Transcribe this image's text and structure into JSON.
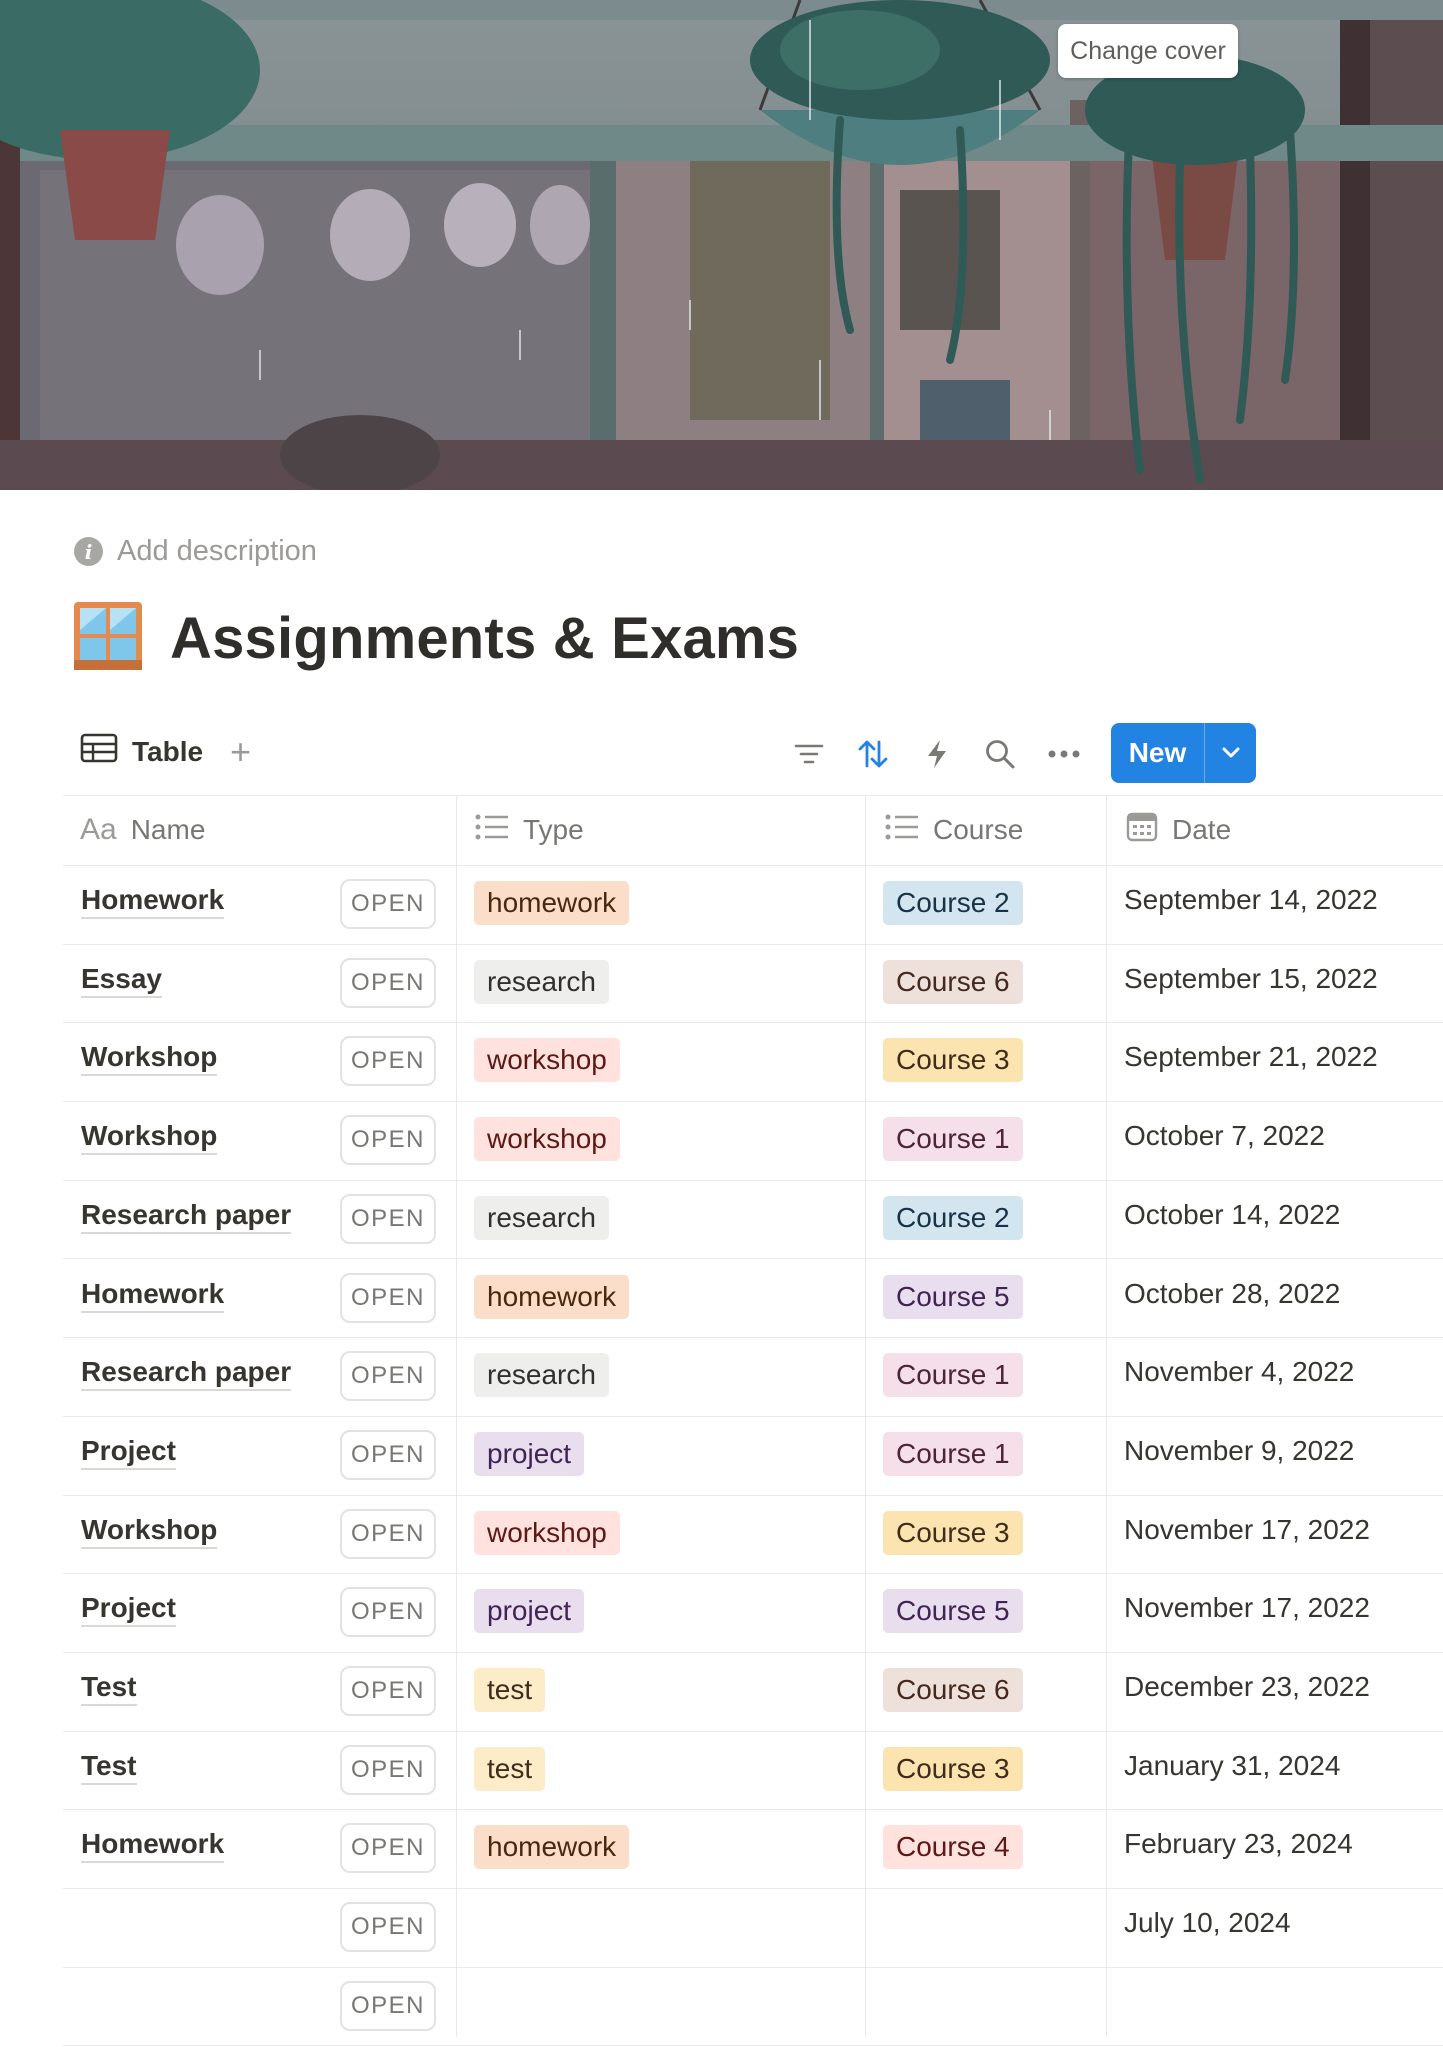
{
  "cover": {
    "change_label": "Change cover"
  },
  "page": {
    "description_label": "Add description",
    "title": "Assignments & Exams",
    "icon": "window-icon"
  },
  "toolbar": {
    "view_label": "Table",
    "add_view": "+",
    "new_label": "New",
    "icons": [
      "filter-icon",
      "sort-icon",
      "lightning-icon",
      "search-icon",
      "more-icon"
    ]
  },
  "columns": [
    {
      "icon": "Aa",
      "label": "Name"
    },
    {
      "icon": "list-icon",
      "label": "Type"
    },
    {
      "icon": "list-icon",
      "label": "Course"
    },
    {
      "icon": "calendar-icon",
      "label": "Date"
    }
  ],
  "open_label": "OPEN",
  "type_colors": {
    "homework": {
      "bg": "#fadec9",
      "fg": "#49290e"
    },
    "research": {
      "bg": "#eeeeed",
      "fg": "#32302c"
    },
    "workshop": {
      "bg": "#ffe2dd",
      "fg": "#5d1715"
    },
    "project": {
      "bg": "#e8deee",
      "fg": "#412454"
    },
    "test": {
      "bg": "#fdecc8",
      "fg": "#402c1b"
    }
  },
  "course_colors": {
    "Course 1": {
      "bg": "#f5e0e9",
      "fg": "#4c2337"
    },
    "Course 2": {
      "bg": "#d3e5ef",
      "fg": "#183347"
    },
    "Course 3": {
      "bg": "#fbe4b0",
      "fg": "#402c1b"
    },
    "Course 4": {
      "bg": "#ffe2dd",
      "fg": "#5d1715"
    },
    "Course 5": {
      "bg": "#e8deee",
      "fg": "#412454"
    },
    "Course 6": {
      "bg": "#eee0da",
      "fg": "#442a1e"
    }
  },
  "rows": [
    {
      "name": "Homework",
      "type": "homework",
      "course": "Course 2",
      "date": "September 14, 2022"
    },
    {
      "name": "Essay",
      "type": "research",
      "course": "Course 6",
      "date": "September 15, 2022"
    },
    {
      "name": "Workshop",
      "type": "workshop",
      "course": "Course 3",
      "date": "September 21, 2022"
    },
    {
      "name": "Workshop",
      "type": "workshop",
      "course": "Course 1",
      "date": "October 7, 2022"
    },
    {
      "name": "Research paper",
      "type": "research",
      "course": "Course 2",
      "date": "October 14, 2022"
    },
    {
      "name": "Homework",
      "type": "homework",
      "course": "Course 5",
      "date": "October 28, 2022"
    },
    {
      "name": "Research paper",
      "type": "research",
      "course": "Course 1",
      "date": "November 4, 2022"
    },
    {
      "name": "Project",
      "type": "project",
      "course": "Course 1",
      "date": "November 9, 2022"
    },
    {
      "name": "Workshop",
      "type": "workshop",
      "course": "Course 3",
      "date": "November 17, 2022"
    },
    {
      "name": "Project",
      "type": "project",
      "course": "Course 5",
      "date": "November 17, 2022"
    },
    {
      "name": "Test",
      "type": "test",
      "course": "Course 6",
      "date": "December 23, 2022"
    },
    {
      "name": "Test",
      "type": "test",
      "course": "Course 3",
      "date": "January 31, 2024"
    },
    {
      "name": "Homework",
      "type": "homework",
      "course": "Course 4",
      "date": "February 23, 2024"
    },
    {
      "name": "",
      "type": "",
      "course": "",
      "date": "July 10, 2024"
    },
    {
      "name": "",
      "type": "",
      "course": "",
      "date": ""
    }
  ]
}
